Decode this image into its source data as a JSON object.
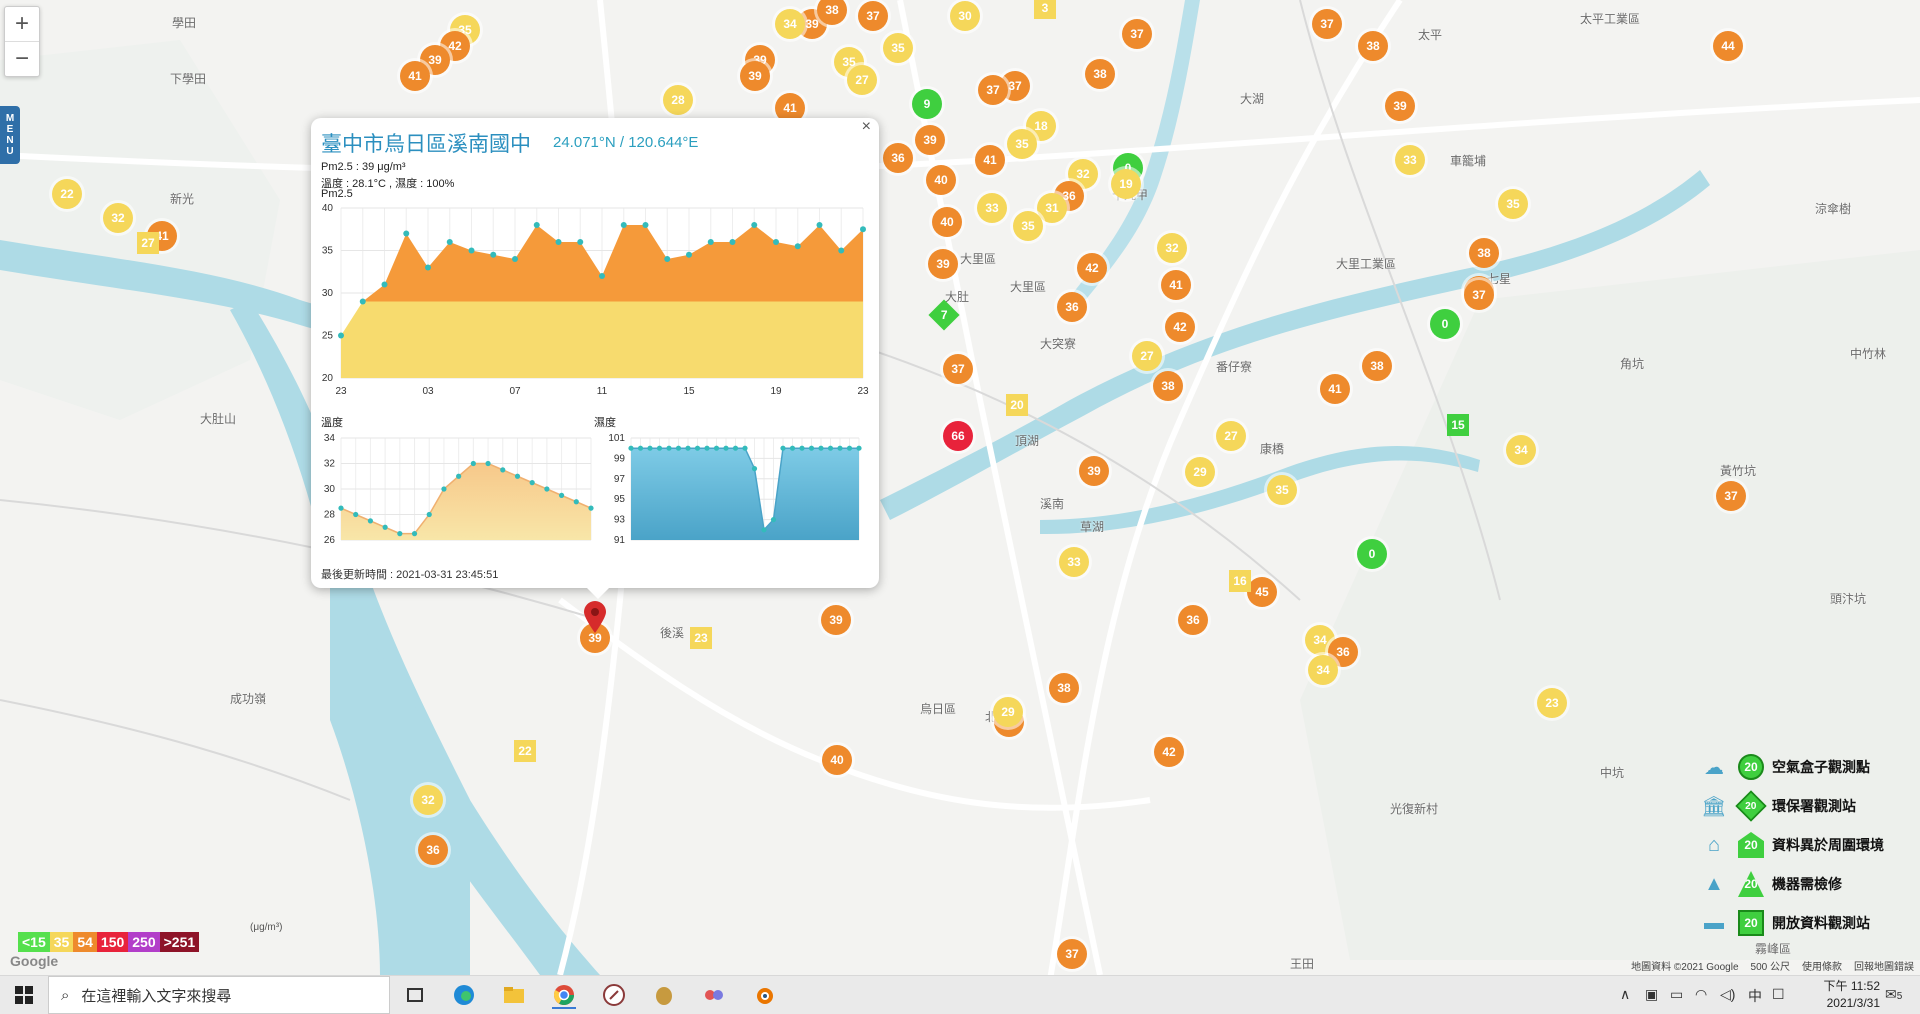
{
  "map": {
    "places": [
      "學田",
      "大肚",
      "下學田",
      "太平",
      "大里區",
      "大里工業區",
      "霧峰區",
      "烏日區",
      "新光",
      "頂湖",
      "康橋",
      "溪南",
      "中坑",
      "草湖",
      "大肚山",
      "成功嶺",
      "大突寮",
      "王田",
      "光復新村",
      "北溝",
      "中竹林",
      "大湖",
      "頭汴坑",
      "黃竹坑",
      "角坑",
      "太平工業區",
      "十九甲",
      "七星",
      "番仔寮",
      "大里區",
      "涼傘樹",
      "車籠埔",
      "後溪"
    ],
    "markers": [
      {
        "v": "35",
        "c": "#f5d75a"
      },
      {
        "v": "39",
        "c": "#ee8a2c"
      },
      {
        "v": "38",
        "c": "#ee8a2c"
      },
      {
        "v": "37",
        "c": "#ee8a2c"
      },
      {
        "v": "30",
        "c": "#f5d75a"
      },
      {
        "v": "42",
        "c": "#ee8a2c"
      },
      {
        "v": "39",
        "c": "#ee8a2c"
      },
      {
        "v": "41",
        "c": "#ee8a2c"
      },
      {
        "v": "39",
        "c": "#ee8a2c"
      },
      {
        "v": "35",
        "c": "#f5d75a"
      },
      {
        "v": "27",
        "c": "#f5d75a"
      },
      {
        "v": "35",
        "c": "#f5d75a"
      },
      {
        "v": "34",
        "c": "#f5d75a"
      },
      {
        "v": "39",
        "c": "#ee8a2c"
      },
      {
        "v": "28",
        "c": "#f5d75a"
      },
      {
        "v": "41",
        "c": "#ee8a2c"
      },
      {
        "v": "9",
        "c": "#3fcf3f"
      },
      {
        "v": "37",
        "c": "#ee8a2c"
      },
      {
        "v": "37",
        "c": "#ee8a2c"
      },
      {
        "v": "38",
        "c": "#ee8a2c"
      },
      {
        "v": "37",
        "c": "#ee8a2c"
      },
      {
        "v": "37",
        "c": "#ee8a2c"
      },
      {
        "v": "38",
        "c": "#ee8a2c"
      },
      {
        "v": "44",
        "c": "#ee8a2c"
      },
      {
        "v": "39",
        "c": "#ee8a2c"
      },
      {
        "v": "18",
        "c": "#f5d75a"
      },
      {
        "v": "35",
        "c": "#f5d75a"
      },
      {
        "v": "39",
        "c": "#ee8a2c"
      },
      {
        "v": "41",
        "c": "#ee8a2c"
      },
      {
        "v": "36",
        "c": "#ee8a2c"
      },
      {
        "v": "32",
        "c": "#f5d75a"
      },
      {
        "v": "0",
        "c": "#3fcf3f"
      },
      {
        "v": "19",
        "c": "#f5d75a"
      },
      {
        "v": "33",
        "c": "#f5d75a"
      },
      {
        "v": "36",
        "c": "#ee8a2c"
      },
      {
        "v": "40",
        "c": "#ee8a2c"
      },
      {
        "v": "33",
        "c": "#f5d75a"
      },
      {
        "v": "31",
        "c": "#f5d75a"
      },
      {
        "v": "35",
        "c": "#f5d75a"
      },
      {
        "v": "40",
        "c": "#ee8a2c"
      },
      {
        "v": "35",
        "c": "#f5d75a"
      },
      {
        "v": "22",
        "c": "#f5d75a"
      },
      {
        "v": "32",
        "c": "#f5d75a"
      },
      {
        "v": "41",
        "c": "#ee8a2c"
      },
      {
        "v": "39",
        "c": "#ee8a2c"
      },
      {
        "v": "42",
        "c": "#ee8a2c"
      },
      {
        "v": "32",
        "c": "#f5d75a"
      },
      {
        "v": "38",
        "c": "#ee8a2c"
      },
      {
        "v": "41",
        "c": "#ee8a2c"
      },
      {
        "v": "36",
        "c": "#ee8a2c"
      },
      {
        "v": "38",
        "c": "#ee8a2c"
      },
      {
        "v": "37",
        "c": "#ee8a2c"
      },
      {
        "v": "0",
        "c": "#3fcf3f"
      },
      {
        "v": "42",
        "c": "#ee8a2c"
      },
      {
        "v": "27",
        "c": "#f5d75a"
      },
      {
        "v": "37",
        "c": "#ee8a2c"
      },
      {
        "v": "38",
        "c": "#ee8a2c"
      },
      {
        "v": "41",
        "c": "#ee8a2c"
      },
      {
        "v": "38",
        "c": "#ee8a2c"
      },
      {
        "v": "66",
        "c": "#e8233b"
      },
      {
        "v": "27",
        "c": "#f5d75a"
      },
      {
        "v": "39",
        "c": "#ee8a2c"
      },
      {
        "v": "29",
        "c": "#f5d75a"
      },
      {
        "v": "35",
        "c": "#f5d75a"
      },
      {
        "v": "34",
        "c": "#f5d75a"
      },
      {
        "v": "37",
        "c": "#ee8a2c"
      },
      {
        "v": "33",
        "c": "#f5d75a"
      },
      {
        "v": "0",
        "c": "#3fcf3f"
      },
      {
        "v": "45",
        "c": "#ee8a2c"
      },
      {
        "v": "36",
        "c": "#ee8a2c"
      },
      {
        "v": "34",
        "c": "#f5d75a"
      },
      {
        "v": "36",
        "c": "#ee8a2c"
      },
      {
        "v": "34",
        "c": "#f5d75a"
      },
      {
        "v": "23",
        "c": "#f5d75a"
      },
      {
        "v": "39",
        "c": "#ee8a2c"
      },
      {
        "v": "38",
        "c": "#ee8a2c"
      },
      {
        "v": "38",
        "c": "#ee8a2c"
      },
      {
        "v": "29",
        "c": "#f5d75a"
      },
      {
        "v": "42",
        "c": "#ee8a2c"
      },
      {
        "v": "40",
        "c": "#ee8a2c"
      },
      {
        "v": "32",
        "c": "#f5d75a"
      },
      {
        "v": "36",
        "c": "#ee8a2c"
      },
      {
        "v": "37",
        "c": "#ee8a2c"
      }
    ],
    "squares": [
      {
        "v": "27",
        "c": "#f5d75a"
      },
      {
        "v": "20",
        "c": "#f5d75a"
      },
      {
        "v": "15",
        "c": "#3fcf3f"
      },
      {
        "v": "16",
        "c": "#f5d75a"
      },
      {
        "v": "23",
        "c": "#f5d75a"
      },
      {
        "v": "22",
        "c": "#f5d75a"
      },
      {
        "v": "3",
        "c": "#f5d75a"
      }
    ],
    "diamond": {
      "v": "7",
      "c": "#3fcf3f"
    }
  },
  "zoom": {
    "in": "+",
    "out": "−"
  },
  "menu_tab": [
    "M",
    "E",
    "N",
    "U"
  ],
  "popup": {
    "close": "×",
    "title": "臺中市烏日區溪南國中",
    "coord": "24.071°N / 120.644°E",
    "pm25": "Pm2.5 : 39 μg/m³",
    "temp_hum": "溫度 : 28.1°C , 濕度 : 100%",
    "pm_label": "Pm2.5",
    "temp_label": "溫度",
    "hum_label": "濕度",
    "updated": "最後更新時間 : 2021-03-31 23:45:51"
  },
  "chart_data": [
    {
      "type": "area",
      "ylabel": "Pm2.5",
      "ylim": [
        20,
        40
      ],
      "yticks": [
        20,
        25,
        30,
        35,
        40
      ],
      "xticks": [
        "23",
        "03",
        "07",
        "11",
        "15",
        "19",
        "23"
      ],
      "values": [
        25,
        29,
        31,
        37,
        33,
        36,
        35,
        34.5,
        34,
        38,
        36,
        36,
        32,
        38,
        38,
        34,
        34.5,
        36,
        36,
        38,
        36,
        35.5,
        38,
        35,
        37.5
      ]
    },
    {
      "type": "area",
      "ylabel": "溫度",
      "ylim": [
        26,
        34
      ],
      "yticks": [
        26,
        28,
        30,
        32,
        34
      ],
      "values": [
        28.5,
        28,
        27.5,
        27,
        26.5,
        26.5,
        28,
        30,
        31,
        32,
        32,
        31.5,
        31,
        30.5,
        30,
        29.5,
        29,
        28.5
      ]
    },
    {
      "type": "area",
      "ylabel": "濕度",
      "ylim": [
        91,
        101
      ],
      "yticks": [
        91,
        93,
        95,
        97,
        99,
        101
      ],
      "values": [
        100,
        100,
        100,
        100,
        100,
        100,
        100,
        100,
        100,
        100,
        100,
        100,
        100,
        98,
        92,
        93,
        100,
        100,
        100,
        100,
        100,
        100,
        100,
        100,
        100
      ]
    }
  ],
  "legend": [
    {
      "label": "空氣盒子觀測點",
      "num": "20"
    },
    {
      "label": "環保署觀測站",
      "num": "20"
    },
    {
      "label": "資料異於周圍環境",
      "num": "20"
    },
    {
      "label": "機器需檢修",
      "num": "20"
    },
    {
      "label": "開放資料觀測站",
      "num": "20"
    }
  ],
  "scale": [
    {
      "t": "<15",
      "c": "#55e04d"
    },
    {
      "t": "35",
      "c": "#f5d75a"
    },
    {
      "t": "54",
      "c": "#ee8a2c"
    },
    {
      "t": "150",
      "c": "#e8233b"
    },
    {
      "t": "250",
      "c": "#b23ec9"
    },
    {
      "t": ">251",
      "c": "#8e1328"
    }
  ],
  "unit": "(μg/m³)",
  "google": "Google",
  "attrib": [
    "地圖資料 ©2021 Google",
    "500 公尺",
    "使用條款",
    "回報地圖錯誤"
  ],
  "taskbar": {
    "search_placeholder": "在這裡輸入文字來搜尋",
    "time": "下午 11:52",
    "date": "2021/3/31",
    "ime": "中",
    "notify": "5"
  }
}
